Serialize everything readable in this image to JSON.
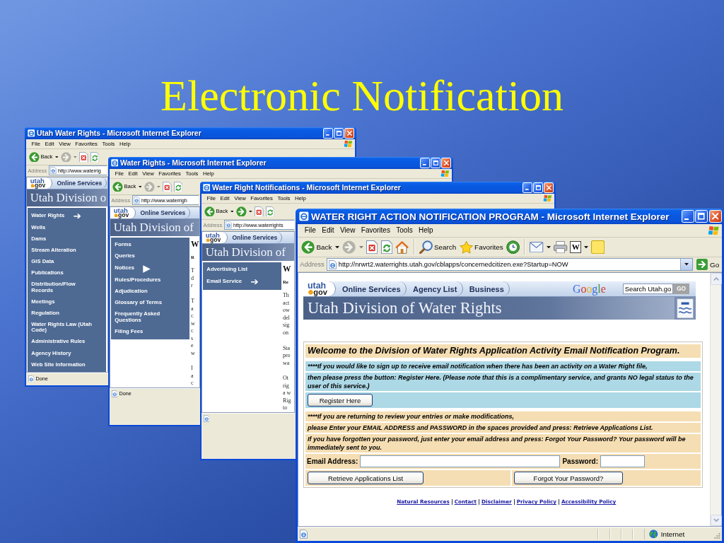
{
  "slide": {
    "title": "Electronic Notification"
  },
  "windows": [
    {
      "title": "Utah Water Rights - Microsoft Internet Explorer",
      "menu": [
        "File",
        "Edit",
        "View",
        "Favorites",
        "Tools",
        "Help"
      ],
      "toolbar": [
        [
          {
            "kind": "back",
            "label": "Back",
            "disabled": false
          },
          {
            "kind": "dropdown",
            "disabled": false
          },
          {
            "kind": "forward",
            "disabled": true
          },
          {
            "kind": "dropdown",
            "disabled": true
          },
          {
            "kind": "stop",
            "disabled": false
          },
          {
            "kind": "refresh",
            "disabled": false
          }
        ]
      ],
      "address": {
        "label": "Address",
        "url": "http://www.waterrig"
      },
      "page": {
        "logo": [
          "utah",
          "gov"
        ],
        "tabs": [
          "Online Services"
        ],
        "header": "Utah Division o",
        "sidebar": [
          {
            "label": "Water Rights",
            "pointer": "➔"
          },
          {
            "label": "Wells"
          },
          {
            "label": "Dams"
          },
          {
            "label": "Stream Alteration"
          },
          {
            "label": "GIS Data"
          },
          {
            "label": "Publications"
          },
          {
            "label": "Distribution/Flow Records"
          },
          {
            "label": "Meetings"
          },
          {
            "label": "Regulation"
          },
          {
            "label": "Water Rights Law (Utah Code)"
          },
          {
            "label": "Administrative Rules"
          },
          {
            "label": "Agency History"
          },
          {
            "label": "Web Site Information"
          }
        ]
      },
      "status": {
        "message": "Done"
      }
    },
    {
      "title": "Water Rights - Microsoft Internet Explorer",
      "menu": [
        "File",
        "Edit",
        "View",
        "Favorites",
        "Tools",
        "Help"
      ],
      "toolbar": [
        [
          {
            "kind": "back",
            "label": "Back",
            "disabled": false
          },
          {
            "kind": "dropdown",
            "disabled": false
          },
          {
            "kind": "forward",
            "disabled": true
          },
          {
            "kind": "dropdown",
            "disabled": true
          },
          {
            "kind": "stop",
            "disabled": false
          },
          {
            "kind": "refresh",
            "disabled": false
          }
        ]
      ],
      "address": {
        "label": "Address",
        "url": "http://www.waterrigh"
      },
      "page": {
        "logo": [
          "utah",
          "gov"
        ],
        "tabs": [
          "Online Services"
        ],
        "header": "Utah Division of",
        "sidebar": [
          {
            "label": "Forms"
          },
          {
            "label": "Queries"
          },
          {
            "label": "Notices",
            "pointer": "▶"
          },
          {
            "label": "Rules/Procedures"
          },
          {
            "label": "Adjudication"
          },
          {
            "label": "Glossary of Terms"
          },
          {
            "label": "Frequently Asked Questions"
          },
          {
            "label": "Filing Fees"
          }
        ],
        "excerpt": {
          "heading": "W",
          "subheading": "R",
          "paragraphs": [
            [
              "T",
              "d",
              "r"
            ],
            [
              "T",
              "a",
              "c",
              "w",
              "c",
              "s",
              "e",
              "w"
            ],
            [
              "I",
              "a",
              "c"
            ]
          ]
        }
      },
      "status": {
        "message": "Done"
      }
    },
    {
      "title": "Water Right Notifications - Microsoft Internet Explorer",
      "menu": [
        "File",
        "Edit",
        "View",
        "Favorites",
        "Tools",
        "Help"
      ],
      "toolbar": [
        [
          {
            "kind": "back",
            "label": "Back",
            "disabled": false
          },
          {
            "kind": "dropdown",
            "disabled": false
          },
          {
            "kind": "forward",
            "disabled": false
          },
          {
            "kind": "dropdown",
            "disabled": false
          },
          {
            "kind": "stop",
            "disabled": false
          },
          {
            "kind": "refresh",
            "disabled": false
          }
        ]
      ],
      "address": {
        "label": "Address",
        "url": "http://www.waterrights"
      },
      "page": {
        "logo": [
          "utah",
          "gov"
        ],
        "tabs": [
          "Online Services"
        ],
        "header": "Utah Division of",
        "sidebar": [
          {
            "label": "Advertising List"
          },
          {
            "label": "Email Service",
            "pointer": "➔"
          }
        ],
        "excerpt": {
          "heading": "W",
          "subheading": "Re",
          "paragraphs": [
            [
              "Th",
              "act",
              "ow",
              "del",
              "sig",
              "on"
            ],
            [
              "Sta",
              "pro",
              "wa"
            ],
            [
              "Ot",
              "rig",
              "a w",
              "Rig",
              "to"
            ]
          ]
        }
      }
    },
    {
      "title": "WATER RIGHT ACTION NOTIFICATION PROGRAM - Microsoft Internet Explorer",
      "menu": [
        "File",
        "Edit",
        "View",
        "Favorites",
        "Tools",
        "Help"
      ],
      "toolbar": [
        [
          {
            "kind": "back",
            "label": "Back",
            "disabled": false
          },
          {
            "kind": "dropdown",
            "disabled": false
          },
          {
            "kind": "forward",
            "disabled": true
          },
          {
            "kind": "dropdown",
            "disabled": true
          },
          {
            "kind": "stop",
            "disabled": false
          },
          {
            "kind": "refresh",
            "disabled": false
          },
          {
            "kind": "home",
            "disabled": false
          }
        ],
        [
          {
            "kind": "search",
            "label": "Search",
            "disabled": false
          },
          {
            "kind": "favorites",
            "label": "Favorites",
            "disabled": false
          },
          {
            "kind": "media",
            "disabled": false
          }
        ],
        [
          {
            "kind": "mail",
            "disabled": false
          },
          {
            "kind": "dropdown",
            "disabled": false
          },
          {
            "kind": "print",
            "disabled": false
          },
          {
            "kind": "word",
            "label": "W",
            "disabled": false
          },
          {
            "kind": "dropdown",
            "disabled": false
          },
          {
            "kind": "notes",
            "disabled": false
          }
        ]
      ],
      "address": {
        "label": "Address",
        "url": "http://nrwrt2.waterrights.utah.gov/cblapps/concernedcitizen.exe?Startup=NOW",
        "go": "Go"
      },
      "page": {
        "logo": [
          "utah",
          "gov"
        ],
        "tabs": [
          "Online Services",
          "Agency List",
          "Business"
        ],
        "search_brand": "Google",
        "search": {
          "value": "Search Utah.go",
          "button": "GO"
        },
        "header": "Utah Division of Water Rights",
        "form": {
          "heading": "Welcome to the Division of Water Rights Application Activity Email Notification Program.",
          "register": {
            "notes": [
              "****If you would like to sign up to receive email notification when there has been an activity on a Water Right file,",
              "then please press the button: Register Here. (Please note that this is a complimentary service, and grants NO legal status to the user of this service.)"
            ],
            "button": "Register Here"
          },
          "login": {
            "notes": [
              "****If you are returning to review your entries or make modifications,",
              "please Enter your EMAIL ADDRESS and PASSWORD in the spaces provided and press: Retrieve Applications List.",
              "If you have forgotten your password, just enter your email address and press: Forgot Your Password? Your password will be immediately sent to you."
            ],
            "email_label": "Email Address:",
            "password_label": "Password:",
            "buttons": [
              "Retrieve Applications List",
              "Forgot Your Password?"
            ]
          }
        },
        "footer_links": [
          "Natural Resources",
          "Contact",
          "Disclaimer",
          "Privacy Policy",
          "Accessibility Policy"
        ]
      },
      "status": {
        "zone": "Internet"
      }
    }
  ]
}
